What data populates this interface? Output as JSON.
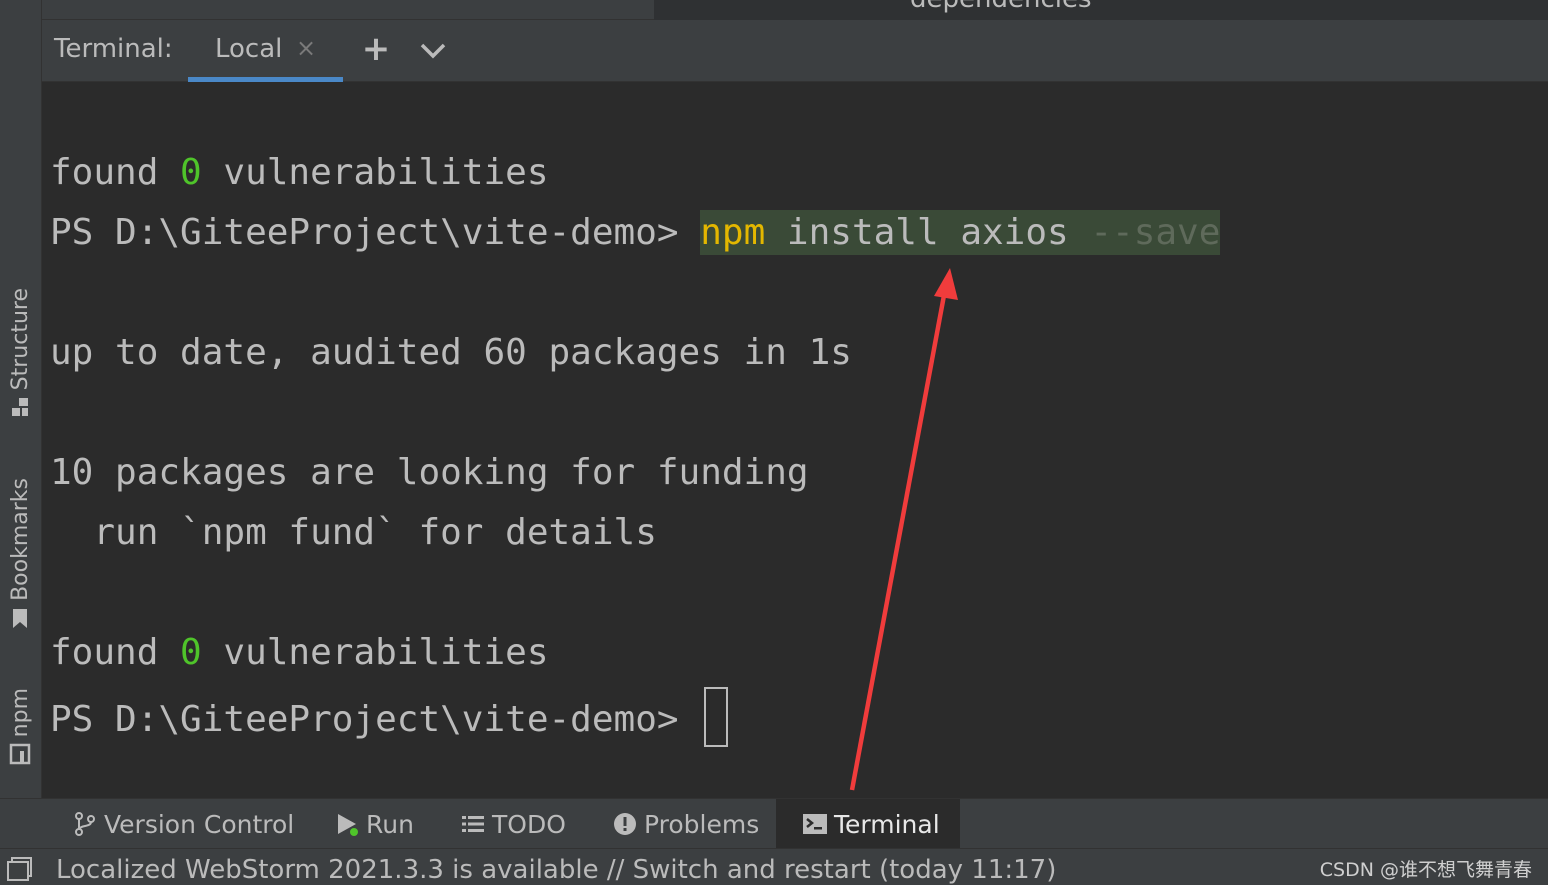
{
  "top_tab_fragment": "dependencies",
  "terminal_header": {
    "title": "Terminal:",
    "active_tab": "Local",
    "close_glyph": "×",
    "add_glyph": "+",
    "more_icon": "chevron-down-icon"
  },
  "side_tabs": [
    {
      "label": "Structure",
      "icon": "structure-icon"
    },
    {
      "label": "Bookmarks",
      "icon": "bookmark-icon"
    },
    {
      "label": "npm",
      "icon": "npm-icon"
    }
  ],
  "terminal": {
    "line1": {
      "pre": "found ",
      "count": "0",
      "post": " vulnerabilities"
    },
    "line2": {
      "prompt": "PS D:\\GiteeProject\\vite-demo> ",
      "cmd_npm": "npm",
      "cmd_rest": " install axios ",
      "cmd_flag": "--save"
    },
    "line3": "up to date, audited 60 packages in 1s",
    "line4": "10 packages are looking for funding",
    "line5": "  run `npm fund` for details",
    "line6": {
      "pre": "found ",
      "count": "0",
      "post": " vulnerabilities"
    },
    "line7": {
      "prompt": "PS D:\\GiteeProject\\vite-demo> "
    }
  },
  "bottom_tabs": [
    {
      "label": "Version Control",
      "icon": "vcs-branch-icon"
    },
    {
      "label": "Run",
      "icon": "run-icon"
    },
    {
      "label": "TODO",
      "icon": "list-icon"
    },
    {
      "label": "Problems",
      "icon": "problems-icon"
    },
    {
      "label": "Terminal",
      "icon": "terminal-icon",
      "active": true
    }
  ],
  "status_bar": {
    "message": "Localized WebStorm 2021.3.3 is available // Switch and restart (today 11:17)"
  },
  "watermark": "CSDN @谁不想飞舞青春",
  "colors": {
    "background": "#2b2b2b",
    "panel": "#3c3f41",
    "accent_underline": "#4a88c7",
    "zero_count": "#4fc42a",
    "npm_keyword": "#e3b700",
    "command_highlight": "#3a4a37",
    "annotation_arrow": "#f03c3c"
  }
}
